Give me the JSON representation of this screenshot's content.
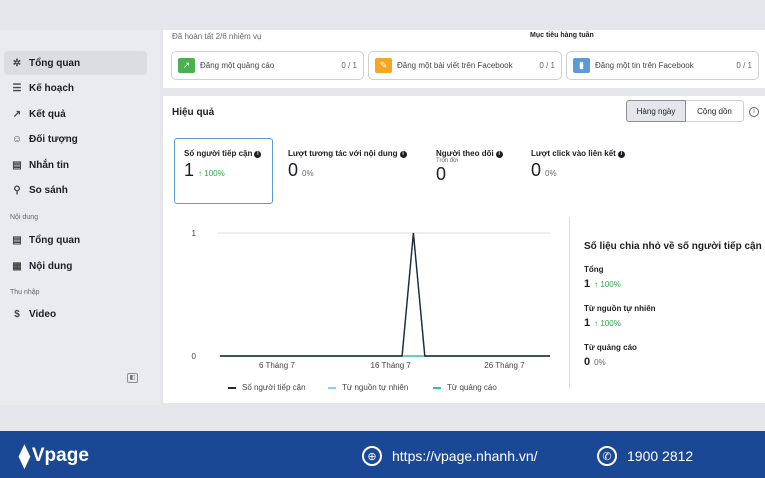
{
  "sidebar": {
    "items": [
      {
        "label": "Tổng quan",
        "icon": "overview-icon",
        "glyph": "✲"
      },
      {
        "label": "Kế hoạch",
        "icon": "plan-icon",
        "glyph": "☰"
      },
      {
        "label": "Kết quả",
        "icon": "results-icon",
        "glyph": "↗"
      },
      {
        "label": "Đối tượng",
        "icon": "audience-icon",
        "glyph": "☺"
      },
      {
        "label": "Nhắn tin",
        "icon": "messages-icon",
        "glyph": "▤"
      },
      {
        "label": "So sánh",
        "icon": "compare-icon",
        "glyph": "⚲"
      }
    ],
    "content_section": "Nội dung",
    "content_items": [
      {
        "label": "Tổng quan",
        "icon": "content-overview-icon",
        "glyph": "▤"
      },
      {
        "label": "Nội dung",
        "icon": "content-table-icon",
        "glyph": "▦"
      }
    ],
    "income_section": "Thu nhập",
    "income_items": [
      {
        "label": "Video",
        "icon": "video-income-icon",
        "glyph": "$"
      }
    ]
  },
  "tasks": {
    "progress": "Đã hoàn tất 2/6 nhiệm vụ",
    "weekly_goal": "Mục tiêu hàng tuần",
    "cards": [
      {
        "label": "Đăng một quảng cáo",
        "count": "0 / 1",
        "icon": "ad-trend-icon",
        "color": "#4caf50"
      },
      {
        "label": "Đăng một bài viết trên Facebook",
        "count": "0 / 1",
        "icon": "post-pencil-icon",
        "color": "#f5a623"
      },
      {
        "label": "Đăng một tin trên Facebook",
        "count": "0 / 1",
        "icon": "story-book-icon",
        "color": "#5b9bd5"
      }
    ]
  },
  "performance": {
    "title": "Hiệu quả",
    "toggle": [
      "Hàng ngày",
      "Cộng dồn"
    ],
    "metrics": [
      {
        "label": "Số người tiếp cận",
        "value": "1",
        "change": "↑ 100%"
      },
      {
        "label": "Lượt tương tác với nội dung",
        "value": "0",
        "change": "0%"
      },
      {
        "label": "Người theo dõi",
        "sub": "Trọn đời",
        "value": "0"
      },
      {
        "label": "Lượt click vào liên kết",
        "value": "0",
        "change": "0%"
      }
    ]
  },
  "breakdown": {
    "title": "Số liệu chia nhỏ về số người tiếp cận",
    "rows": [
      {
        "label": "Tổng",
        "value": "1",
        "change": "↑ 100%"
      },
      {
        "label": "Từ nguồn tự nhiên",
        "value": "1",
        "change": "↑ 100%"
      },
      {
        "label": "Từ quảng cáo",
        "value": "0",
        "change": "0%"
      }
    ]
  },
  "chart_data": {
    "type": "line",
    "x": [
      "1 Tháng 7",
      "2 Tháng 7",
      "3 Tháng 7",
      "4 Tháng 7",
      "5 Tháng 7",
      "6 Tháng 7",
      "7 Tháng 7",
      "8 Tháng 7",
      "9 Tháng 7",
      "10 Tháng 7",
      "11 Tháng 7",
      "12 Tháng 7",
      "13 Tháng 7",
      "14 Tháng 7",
      "15 Tháng 7",
      "16 Tháng 7",
      "17 Tháng 7",
      "18 Tháng 7",
      "19 Tháng 7",
      "20 Tháng 7",
      "21 Tháng 7",
      "22 Tháng 7",
      "23 Tháng 7",
      "24 Tháng 7",
      "25 Tháng 7",
      "26 Tháng 7",
      "27 Tháng 7",
      "28 Tháng 7",
      "29 Tháng 7",
      "30 Tháng 7"
    ],
    "tick_labels": [
      "6 Tháng 7",
      "16 Tháng 7",
      "26 Tháng 7"
    ],
    "y_ticks": [
      "0",
      "1"
    ],
    "ylim": [
      0,
      1
    ],
    "grid": true,
    "legend": "bottom",
    "series": [
      {
        "name": "Số người tiếp cận",
        "color": "#1c2b36",
        "values": [
          0,
          0,
          0,
          0,
          0,
          0,
          0,
          0,
          0,
          0,
          0,
          0,
          0,
          0,
          0,
          0,
          0,
          1,
          0,
          0,
          0,
          0,
          0,
          0,
          0,
          0,
          0,
          0,
          0,
          0
        ]
      },
      {
        "name": "Từ nguồn tự nhiên",
        "color": "#8ecdf0",
        "values": [
          0,
          0,
          0,
          0,
          0,
          0,
          0,
          0,
          0,
          0,
          0,
          0,
          0,
          0,
          0,
          0,
          0,
          1,
          0,
          0,
          0,
          0,
          0,
          0,
          0,
          0,
          0,
          0,
          0,
          0
        ]
      },
      {
        "name": "Từ quảng cáo",
        "color": "#2ec4b6",
        "values": [
          0,
          0,
          0,
          0,
          0,
          0,
          0,
          0,
          0,
          0,
          0,
          0,
          0,
          0,
          0,
          0,
          0,
          0,
          0,
          0,
          0,
          0,
          0,
          0,
          0,
          0,
          0,
          0,
          0,
          0
        ]
      }
    ]
  },
  "footer": {
    "brand": "Vpage",
    "website": "https://vpage.nhanh.vn/",
    "phone": "1900 2812",
    "bg": "#1b4895"
  }
}
